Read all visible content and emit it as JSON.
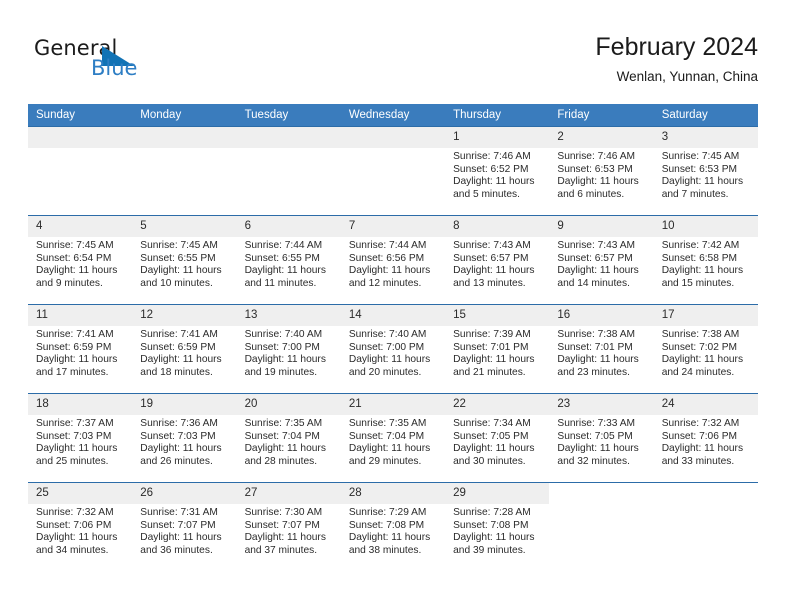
{
  "brand": {
    "word1": "General",
    "word2": "Blue",
    "logo_icon": "triangle-logo-icon",
    "accent_color": "#2e7ec4"
  },
  "header": {
    "title": "February 2024",
    "subtitle": "Wenlan, Yunnan, China"
  },
  "calendar": {
    "header_bg": "#3a7cbd",
    "row_divider": "#2c6ca8",
    "daynum_bg": "#efefef",
    "weekdays": [
      "Sunday",
      "Monday",
      "Tuesday",
      "Wednesday",
      "Thursday",
      "Friday",
      "Saturday"
    ],
    "weeks": [
      [
        {
          "day": "",
          "lines": []
        },
        {
          "day": "",
          "lines": []
        },
        {
          "day": "",
          "lines": []
        },
        {
          "day": "",
          "lines": []
        },
        {
          "day": "1",
          "lines": [
            "Sunrise: 7:46 AM",
            "Sunset: 6:52 PM",
            "Daylight: 11 hours",
            "and 5 minutes."
          ]
        },
        {
          "day": "2",
          "lines": [
            "Sunrise: 7:46 AM",
            "Sunset: 6:53 PM",
            "Daylight: 11 hours",
            "and 6 minutes."
          ]
        },
        {
          "day": "3",
          "lines": [
            "Sunrise: 7:45 AM",
            "Sunset: 6:53 PM",
            "Daylight: 11 hours",
            "and 7 minutes."
          ]
        }
      ],
      [
        {
          "day": "4",
          "lines": [
            "Sunrise: 7:45 AM",
            "Sunset: 6:54 PM",
            "Daylight: 11 hours",
            "and 9 minutes."
          ]
        },
        {
          "day": "5",
          "lines": [
            "Sunrise: 7:45 AM",
            "Sunset: 6:55 PM",
            "Daylight: 11 hours",
            "and 10 minutes."
          ]
        },
        {
          "day": "6",
          "lines": [
            "Sunrise: 7:44 AM",
            "Sunset: 6:55 PM",
            "Daylight: 11 hours",
            "and 11 minutes."
          ]
        },
        {
          "day": "7",
          "lines": [
            "Sunrise: 7:44 AM",
            "Sunset: 6:56 PM",
            "Daylight: 11 hours",
            "and 12 minutes."
          ]
        },
        {
          "day": "8",
          "lines": [
            "Sunrise: 7:43 AM",
            "Sunset: 6:57 PM",
            "Daylight: 11 hours",
            "and 13 minutes."
          ]
        },
        {
          "day": "9",
          "lines": [
            "Sunrise: 7:43 AM",
            "Sunset: 6:57 PM",
            "Daylight: 11 hours",
            "and 14 minutes."
          ]
        },
        {
          "day": "10",
          "lines": [
            "Sunrise: 7:42 AM",
            "Sunset: 6:58 PM",
            "Daylight: 11 hours",
            "and 15 minutes."
          ]
        }
      ],
      [
        {
          "day": "11",
          "lines": [
            "Sunrise: 7:41 AM",
            "Sunset: 6:59 PM",
            "Daylight: 11 hours",
            "and 17 minutes."
          ]
        },
        {
          "day": "12",
          "lines": [
            "Sunrise: 7:41 AM",
            "Sunset: 6:59 PM",
            "Daylight: 11 hours",
            "and 18 minutes."
          ]
        },
        {
          "day": "13",
          "lines": [
            "Sunrise: 7:40 AM",
            "Sunset: 7:00 PM",
            "Daylight: 11 hours",
            "and 19 minutes."
          ]
        },
        {
          "day": "14",
          "lines": [
            "Sunrise: 7:40 AM",
            "Sunset: 7:00 PM",
            "Daylight: 11 hours",
            "and 20 minutes."
          ]
        },
        {
          "day": "15",
          "lines": [
            "Sunrise: 7:39 AM",
            "Sunset: 7:01 PM",
            "Daylight: 11 hours",
            "and 21 minutes."
          ]
        },
        {
          "day": "16",
          "lines": [
            "Sunrise: 7:38 AM",
            "Sunset: 7:01 PM",
            "Daylight: 11 hours",
            "and 23 minutes."
          ]
        },
        {
          "day": "17",
          "lines": [
            "Sunrise: 7:38 AM",
            "Sunset: 7:02 PM",
            "Daylight: 11 hours",
            "and 24 minutes."
          ]
        }
      ],
      [
        {
          "day": "18",
          "lines": [
            "Sunrise: 7:37 AM",
            "Sunset: 7:03 PM",
            "Daylight: 11 hours",
            "and 25 minutes."
          ]
        },
        {
          "day": "19",
          "lines": [
            "Sunrise: 7:36 AM",
            "Sunset: 7:03 PM",
            "Daylight: 11 hours",
            "and 26 minutes."
          ]
        },
        {
          "day": "20",
          "lines": [
            "Sunrise: 7:35 AM",
            "Sunset: 7:04 PM",
            "Daylight: 11 hours",
            "and 28 minutes."
          ]
        },
        {
          "day": "21",
          "lines": [
            "Sunrise: 7:35 AM",
            "Sunset: 7:04 PM",
            "Daylight: 11 hours",
            "and 29 minutes."
          ]
        },
        {
          "day": "22",
          "lines": [
            "Sunrise: 7:34 AM",
            "Sunset: 7:05 PM",
            "Daylight: 11 hours",
            "and 30 minutes."
          ]
        },
        {
          "day": "23",
          "lines": [
            "Sunrise: 7:33 AM",
            "Sunset: 7:05 PM",
            "Daylight: 11 hours",
            "and 32 minutes."
          ]
        },
        {
          "day": "24",
          "lines": [
            "Sunrise: 7:32 AM",
            "Sunset: 7:06 PM",
            "Daylight: 11 hours",
            "and 33 minutes."
          ]
        }
      ],
      [
        {
          "day": "25",
          "lines": [
            "Sunrise: 7:32 AM",
            "Sunset: 7:06 PM",
            "Daylight: 11 hours",
            "and 34 minutes."
          ]
        },
        {
          "day": "26",
          "lines": [
            "Sunrise: 7:31 AM",
            "Sunset: 7:07 PM",
            "Daylight: 11 hours",
            "and 36 minutes."
          ]
        },
        {
          "day": "27",
          "lines": [
            "Sunrise: 7:30 AM",
            "Sunset: 7:07 PM",
            "Daylight: 11 hours",
            "and 37 minutes."
          ]
        },
        {
          "day": "28",
          "lines": [
            "Sunrise: 7:29 AM",
            "Sunset: 7:08 PM",
            "Daylight: 11 hours",
            "and 38 minutes."
          ]
        },
        {
          "day": "29",
          "lines": [
            "Sunrise: 7:28 AM",
            "Sunset: 7:08 PM",
            "Daylight: 11 hours",
            "and 39 minutes."
          ]
        },
        {
          "day": "",
          "lines": []
        },
        {
          "day": "",
          "lines": []
        }
      ]
    ]
  }
}
